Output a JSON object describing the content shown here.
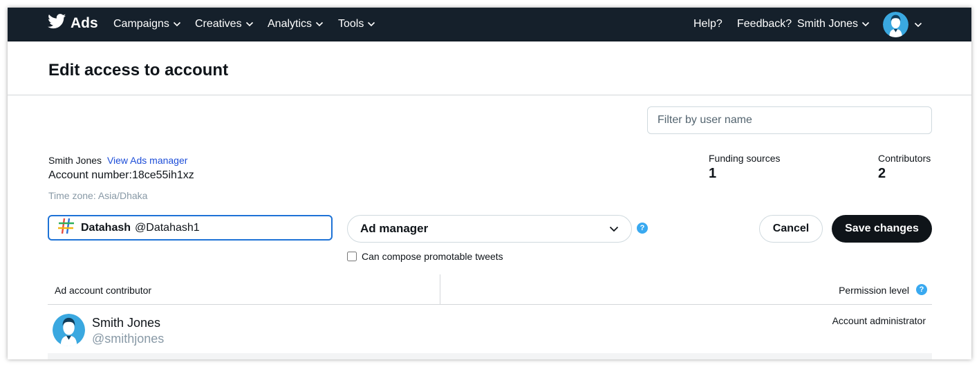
{
  "nav": {
    "brand": "Ads",
    "items": [
      {
        "label": "Campaigns"
      },
      {
        "label": "Creatives"
      },
      {
        "label": "Analytics"
      },
      {
        "label": "Tools"
      }
    ],
    "help": "Help?",
    "feedback": "Feedback?",
    "user": "Smith Jones"
  },
  "page": {
    "title": "Edit access to account"
  },
  "filter": {
    "placeholder": "Filter by user name",
    "value": ""
  },
  "account": {
    "name": "Smith Jones",
    "link": "View Ads manager",
    "number": "Account number:18ce55ih1xz",
    "timezone": "Time zone: Asia/Dhaka"
  },
  "stats": {
    "funding_label": "Funding sources",
    "funding_value": "1",
    "contributors_label": "Contributors",
    "contributors_value": "2"
  },
  "form": {
    "selected_user_name": "Datahash",
    "selected_user_handle": "@Datahash1",
    "role_value": "Ad manager",
    "help_glyph": "?",
    "cancel": "Cancel",
    "save": "Save changes",
    "compose_label": "Can compose promotable tweets",
    "compose_checked": false
  },
  "table": {
    "col_contributor": "Ad account contributor",
    "col_permission": "Permission level",
    "rows": [
      {
        "name": "Smith Jones",
        "handle": "@smithjones",
        "permission": "Account administrator"
      }
    ]
  },
  "colors": {
    "nav_bg": "#15202b",
    "accent_blue": "#1d72d6",
    "help_blue": "#39a9f0",
    "link_blue": "#1d4ed8",
    "avatar_bg": "#3aa8e0",
    "save_bg": "#0f1419"
  },
  "icons": {
    "brand": "twitter-bird-icon",
    "chevron": "chevron-down-icon",
    "avatar": "avatar-silhouette-icon",
    "datahash": "datahash-logo-icon",
    "help": "question-circle-icon"
  }
}
